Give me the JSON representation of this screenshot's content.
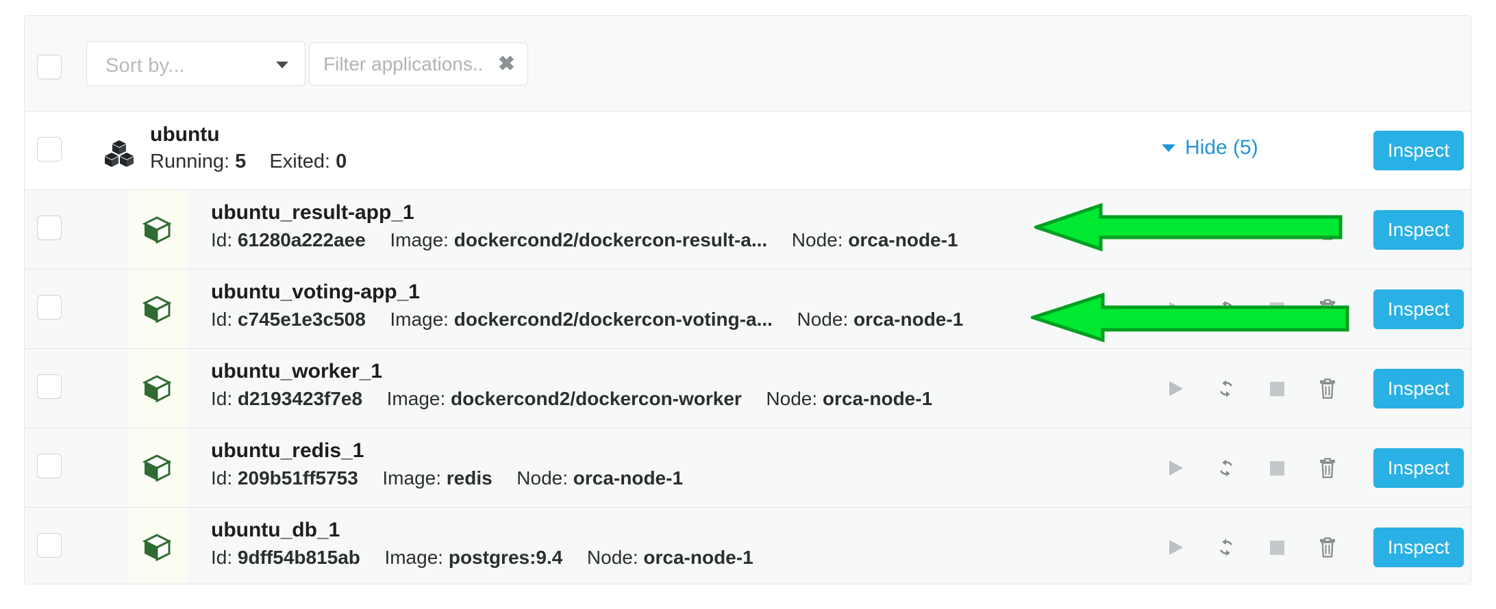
{
  "toolbar": {
    "select_all_checkbox": "",
    "sort_by_label": "Sort by...",
    "filter_value": "",
    "filter_placeholder": "Filter applications...",
    "clear_icon": "✖"
  },
  "stack": {
    "name": "ubuntu",
    "running_label": "Running:",
    "running_count": "5",
    "exited_label": "Exited:",
    "exited_count": "0",
    "hide_label": "Hide (5)",
    "inspect_label": "Inspect"
  },
  "labels": {
    "id_label": "Id:",
    "image_label": "Image:",
    "node_label": "Node:",
    "inspect_label": "Inspect"
  },
  "containers": [
    {
      "name": "ubuntu_result-app_1",
      "id": "61280a222aee",
      "image": "dockercond2/dockercon-result-a...",
      "node": "orca-node-1",
      "inspect_label": "Inspect",
      "actions_hidden_by_arrow": true
    },
    {
      "name": "ubuntu_voting-app_1",
      "id": "c745e1e3c508",
      "image": "dockercond2/dockercon-voting-a...",
      "node": "orca-node-1",
      "inspect_label": "Inspect",
      "actions_hidden_by_arrow": true
    },
    {
      "name": "ubuntu_worker_1",
      "id": "d2193423f7e8",
      "image": "dockercond2/dockercon-worker",
      "node": "orca-node-1",
      "inspect_label": "Inspect",
      "actions_hidden_by_arrow": false
    },
    {
      "name": "ubuntu_redis_1",
      "id": "209b51ff5753",
      "image": "redis",
      "node": "orca-node-1",
      "inspect_label": "Inspect",
      "actions_hidden_by_arrow": false
    },
    {
      "name": "ubuntu_db_1",
      "id": "9dff54b815ab",
      "image": "postgres:9.4",
      "node": "orca-node-1",
      "inspect_label": "Inspect",
      "actions_hidden_by_arrow": false
    }
  ],
  "row_actions": [
    {
      "icon": "play-icon"
    },
    {
      "icon": "restart-icon"
    },
    {
      "icon": "stop-icon"
    },
    {
      "icon": "trash-icon"
    }
  ],
  "annotations": [
    {
      "shape": "left-arrow",
      "target_row": 0
    },
    {
      "shape": "left-arrow",
      "target_row": 1
    }
  ],
  "colors": {
    "accent_blue": "#29b0e4",
    "link_blue": "#2196d6",
    "container_icon_green": "#2f6b33",
    "icon_strip_bg": "#fbfdf2",
    "row_bg": "#f7f8f8",
    "toolbar_bg": "#f8f9fa",
    "arrow_fill": "#00e832",
    "arrow_stroke": "#00a020",
    "action_icon_gray": "#b4b8bb",
    "placeholder_gray": "#b6babd"
  }
}
